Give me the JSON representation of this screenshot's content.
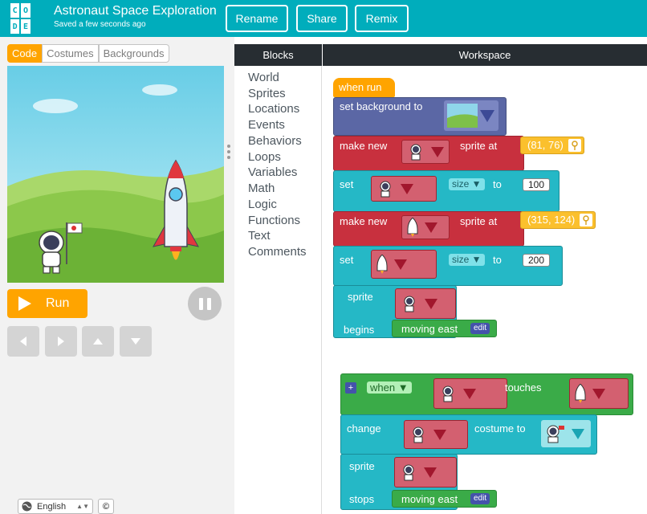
{
  "header": {
    "logo_letters": [
      "C",
      "O",
      "D",
      "E"
    ],
    "title": "Astronaut Space Exploration",
    "saved_status": "Saved a few seconds ago",
    "buttons": {
      "rename": "Rename",
      "share": "Share",
      "remix": "Remix"
    }
  },
  "left": {
    "tabs": {
      "code": "Code",
      "costumes": "Costumes",
      "backgrounds": "Backgrounds"
    },
    "run_label": "Run",
    "language": "English",
    "copyright": "©"
  },
  "panels": {
    "blocks": "Blocks",
    "workspace": "Workspace"
  },
  "categories": [
    "World",
    "Sprites",
    "Locations",
    "Events",
    "Behaviors",
    "Loops",
    "Variables",
    "Math",
    "Logic",
    "Functions",
    "Text",
    "Comments"
  ],
  "script1": {
    "when_run": "when run",
    "set_background": "set background to",
    "make_new_1": "make new",
    "sprite_at_1": "sprite at",
    "coord_1": "(81, 76)",
    "set_1": "set",
    "size_1": "size",
    "to_1": "to",
    "value_1": "100",
    "make_new_2": "make new",
    "sprite_at_2": "sprite at",
    "coord_2": "(315, 124)",
    "set_2": "set",
    "size_2": "size",
    "to_2": "to",
    "value_2": "200",
    "sprite": "sprite",
    "begins": "begins",
    "moving": "moving east",
    "edit": "edit"
  },
  "script2": {
    "plus": "+",
    "when": "when",
    "touches": "touches",
    "change": "change",
    "costume_to": "costume to",
    "sprite": "sprite",
    "stops": "stops",
    "moving": "moving east",
    "edit": "edit"
  },
  "colors": {
    "header": "#00adbc",
    "orange": "#ffa400",
    "block_red": "#c8303e",
    "block_teal": "#25b8c6",
    "block_purple": "#5b67a5",
    "block_green": "#3aab48"
  }
}
